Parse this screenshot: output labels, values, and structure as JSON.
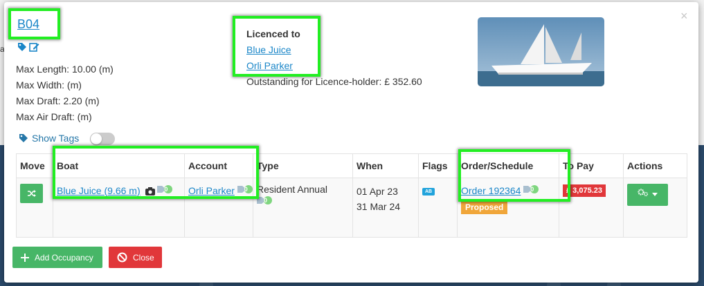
{
  "berth": {
    "code": "B04"
  },
  "specs": [
    "Max Length: 10.00 (m)",
    "Max Width: (m)",
    "Max Draft: 2.20 (m)",
    "Max Air Draft: (m)"
  ],
  "licence": {
    "title": "Licenced to",
    "holders": [
      "Blue Juice",
      "Orli Parker"
    ],
    "outstanding": "Outstanding for Licence-holder: £ 352.60"
  },
  "tags": {
    "show_label": "Show Tags",
    "enabled": false
  },
  "table": {
    "headers": [
      "Move",
      "Boat",
      "Account",
      "Type",
      "When",
      "Flags",
      "Order/Schedule",
      "To Pay",
      "Actions"
    ],
    "row": {
      "boat": "Blue Juice (9.66 m)",
      "boat_tag_count": "0",
      "account": "Orli Parker",
      "account_tag_count": "0",
      "type": "Resident Annual",
      "type_tag_count": "0",
      "when_start": "01 Apr 23",
      "when_end": "31 Mar 24",
      "flag": "AB",
      "order": "Order 192364",
      "order_tag_count": "0",
      "status": "Proposed",
      "to_pay": "£ 3,075.23"
    }
  },
  "buttons": {
    "add_occupancy": "Add Occupancy",
    "close": "Close",
    "close_x": "×"
  },
  "colors": {
    "accent": "#1a86c8",
    "green": "#47b667",
    "red": "#e1373a",
    "orange": "#f0a63a",
    "highlight": "#22ee22"
  }
}
